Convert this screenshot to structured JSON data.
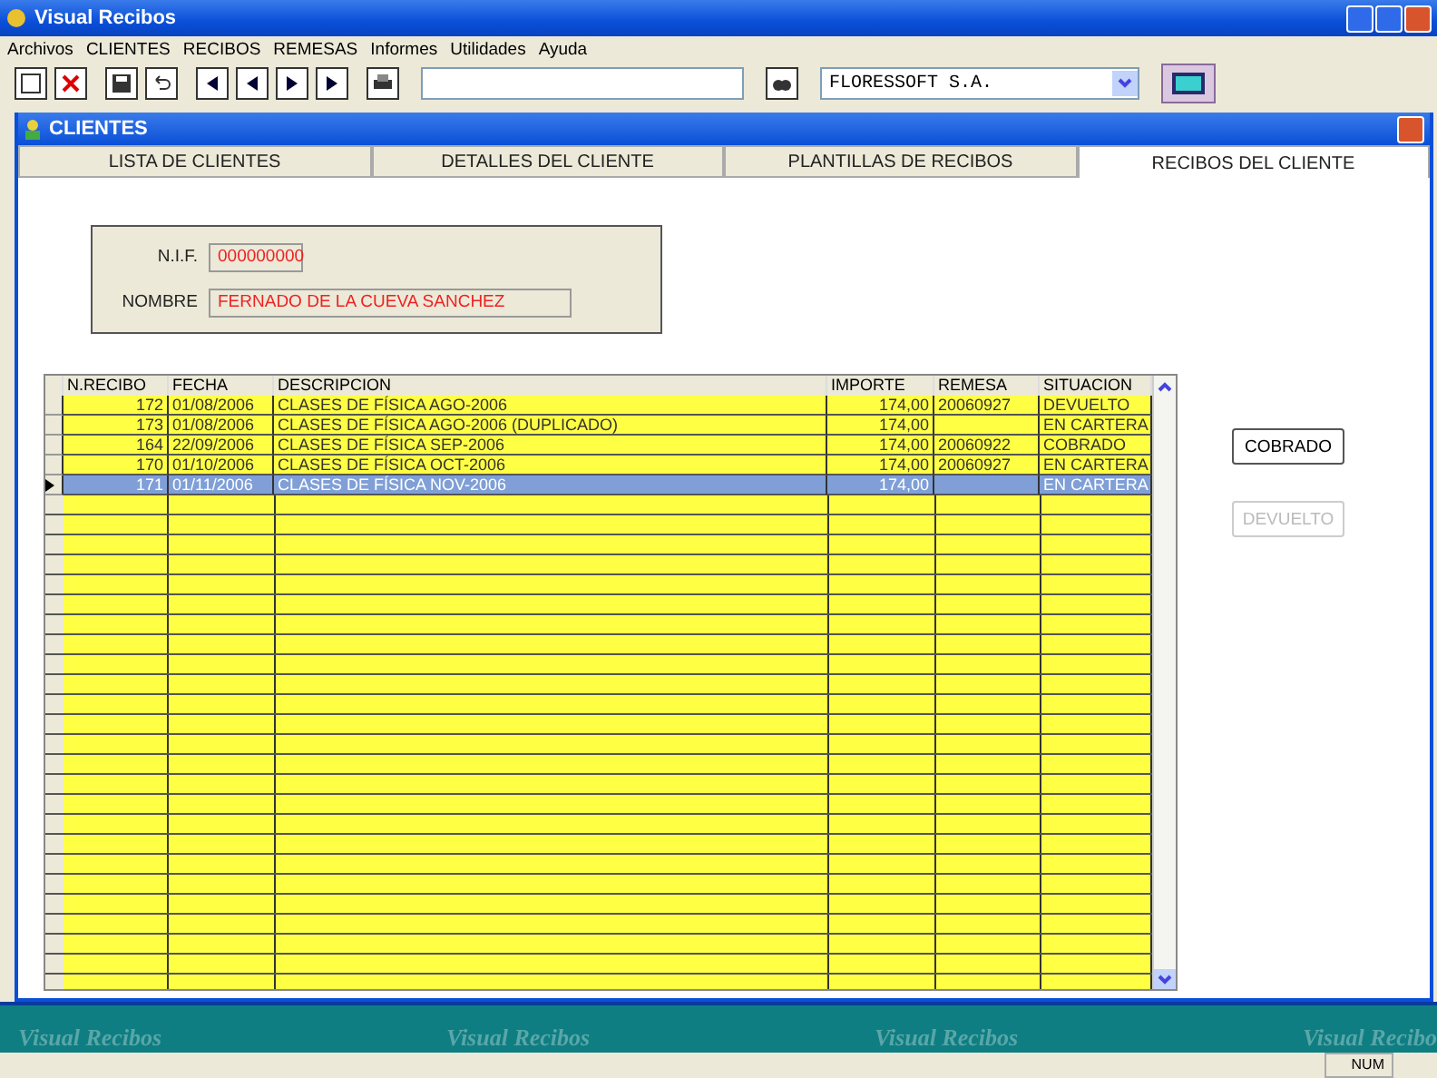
{
  "window": {
    "title": "Visual Recibos"
  },
  "menu": [
    "Archivos",
    "CLIENTES",
    "RECIBOS",
    "REMESAS",
    "Informes",
    "Utilidades",
    "Ayuda"
  ],
  "toolbar": {
    "company": "FLORESSOFT S.A."
  },
  "child": {
    "title": "CLIENTES"
  },
  "tabs": [
    {
      "label": "LISTA DE CLIENTES",
      "selected": false
    },
    {
      "label": "DETALLES DEL CLIENTE",
      "selected": false
    },
    {
      "label": "PLANTILLAS DE RECIBOS",
      "selected": false
    },
    {
      "label": "RECIBOS DEL CLIENTE",
      "selected": true
    }
  ],
  "client": {
    "nif_label": "N.I.F.",
    "nif": "000000000",
    "name_label": "NOMBRE",
    "name": "FERNADO DE LA CUEVA SANCHEZ"
  },
  "table": {
    "columns": [
      "N.RECIBO",
      "FECHA",
      "DESCRIPCION",
      "IMPORTE",
      "REMESA",
      "SITUACION"
    ],
    "rows": [
      {
        "cells": [
          "172",
          "01/08/2006",
          "CLASES DE FÍSICA AGO-2006",
          "174,00",
          "20060927",
          "DEVUELTO"
        ],
        "selected": false
      },
      {
        "cells": [
          "173",
          "01/08/2006",
          "CLASES DE FÍSICA AGO-2006 (DUPLICADO)",
          "174,00",
          "",
          "EN CARTERA"
        ],
        "selected": false
      },
      {
        "cells": [
          "164",
          "22/09/2006",
          "CLASES DE FÍSICA SEP-2006",
          "174,00",
          "20060922",
          "COBRADO"
        ],
        "selected": false
      },
      {
        "cells": [
          "170",
          "01/10/2006",
          "CLASES DE FÍSICA OCT-2006",
          "174,00",
          "20060927",
          "EN CARTERA"
        ],
        "selected": false
      },
      {
        "cells": [
          "171",
          "01/11/2006",
          "CLASES DE FÍSICA NOV-2006",
          "174,00",
          "",
          "EN CARTERA"
        ],
        "selected": true
      }
    ]
  },
  "buttons": [
    {
      "label": "COBRADO",
      "disabled": false
    },
    {
      "label": "DEVUELTO",
      "disabled": true
    }
  ],
  "background_texts": [
    "Visual Recibos",
    "Visual Recibos",
    "Visual Recibos",
    "Visual Recibo"
  ],
  "status_bar": {
    "num": "NUM"
  }
}
